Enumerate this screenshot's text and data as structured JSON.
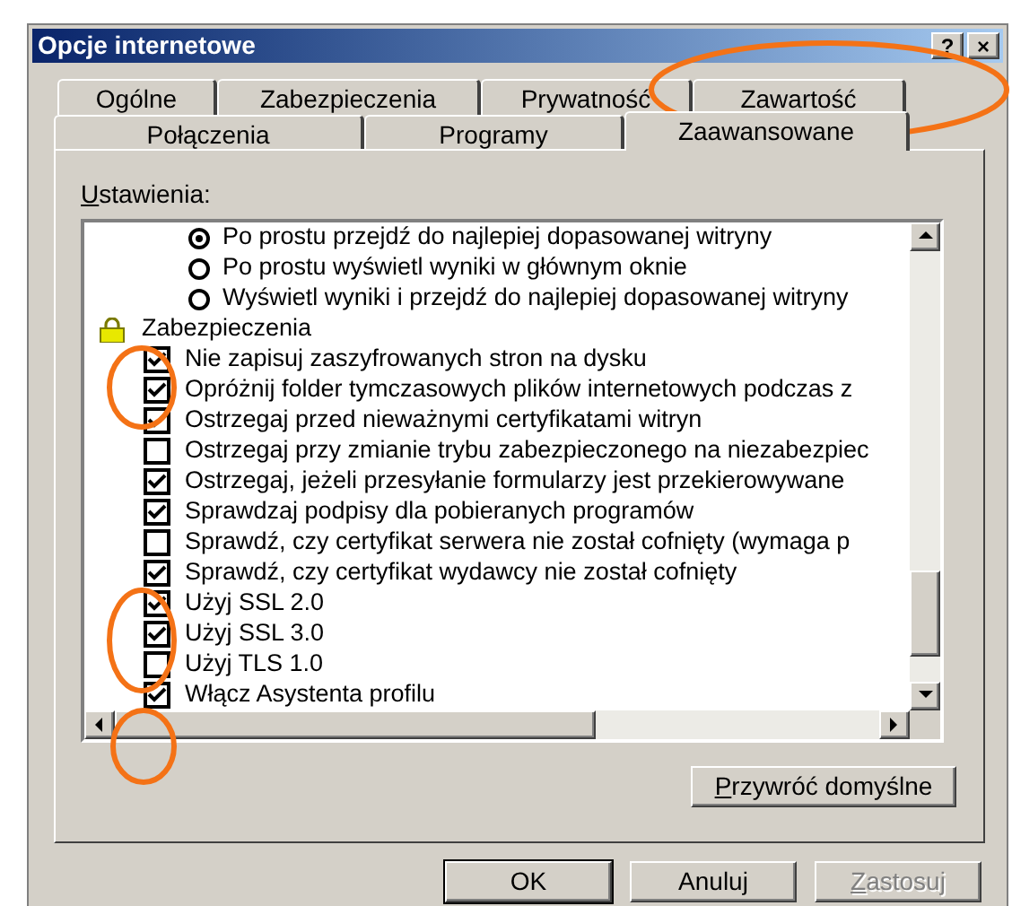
{
  "window": {
    "title": "Opcje internetowe"
  },
  "title_buttons": [
    "?",
    "×"
  ],
  "tab_rows": [
    [
      {
        "label": "Ogólne",
        "selected": false
      },
      {
        "label": "Zabezpieczenia",
        "selected": false
      },
      {
        "label": "Prywatność",
        "selected": false
      },
      {
        "label": "Zawartość",
        "selected": false
      }
    ],
    [
      {
        "label": "Połączenia",
        "selected": false
      },
      {
        "label": "Programy",
        "selected": false
      },
      {
        "label": "Zaawansowane",
        "selected": true
      }
    ]
  ],
  "settings_label": {
    "text": "Ustawienia:",
    "mnemonic": true
  },
  "settings": [
    {
      "kind": "radio",
      "label": "Po prostu przejdź do najlepiej dopasowanej witryny",
      "selected": true
    },
    {
      "kind": "radio",
      "label": "Po prostu wyświetl wyniki w głównym oknie",
      "selected": false
    },
    {
      "kind": "radio",
      "label": "Wyświetl wyniki i przejdź do najlepiej dopasowanej witryny",
      "selected": false
    },
    {
      "kind": "group",
      "label": "Zabezpieczenia"
    },
    {
      "kind": "checkbox",
      "label": "Nie zapisuj zaszyfrowanych stron na dysku",
      "checked": true
    },
    {
      "kind": "checkbox",
      "label": "Opróżnij folder tymczasowych plików internetowych podczas z",
      "checked": true
    },
    {
      "kind": "checkbox",
      "label": "Ostrzegaj przed nieważnymi certyfikatami witryn",
      "checked": true
    },
    {
      "kind": "checkbox",
      "label": "Ostrzegaj przy zmianie trybu zabezpieczonego na niezabezpiec",
      "checked": false
    },
    {
      "kind": "checkbox",
      "label": "Ostrzegaj, jeżeli przesyłanie formularzy jest przekierowywane",
      "checked": true
    },
    {
      "kind": "checkbox",
      "label": "Sprawdzaj podpisy dla pobieranych programów",
      "checked": true
    },
    {
      "kind": "checkbox",
      "label": "Sprawdź, czy certyfikat serwera nie został cofnięty (wymaga p",
      "checked": false
    },
    {
      "kind": "checkbox",
      "label": "Sprawdź, czy certyfikat wydawcy nie został cofnięty",
      "checked": true
    },
    {
      "kind": "checkbox",
      "label": "Użyj SSL 2.0",
      "checked": true
    },
    {
      "kind": "checkbox",
      "label": "Użyj SSL 3.0",
      "checked": true
    },
    {
      "kind": "checkbox",
      "label": "Użyj TLS 1.0",
      "checked": false
    },
    {
      "kind": "checkbox",
      "label": "Włącz Asystenta profilu",
      "checked": true
    }
  ],
  "restore_button": {
    "label": "Przywróć domyślne",
    "mnemonic": true
  },
  "buttons": [
    {
      "label": "OK",
      "default": true,
      "disabled": false,
      "mnemonic": false
    },
    {
      "label": "Anuluj",
      "default": false,
      "disabled": false,
      "mnemonic": false
    },
    {
      "label": "Zastosuj",
      "default": false,
      "disabled": true,
      "mnemonic": true
    }
  ]
}
